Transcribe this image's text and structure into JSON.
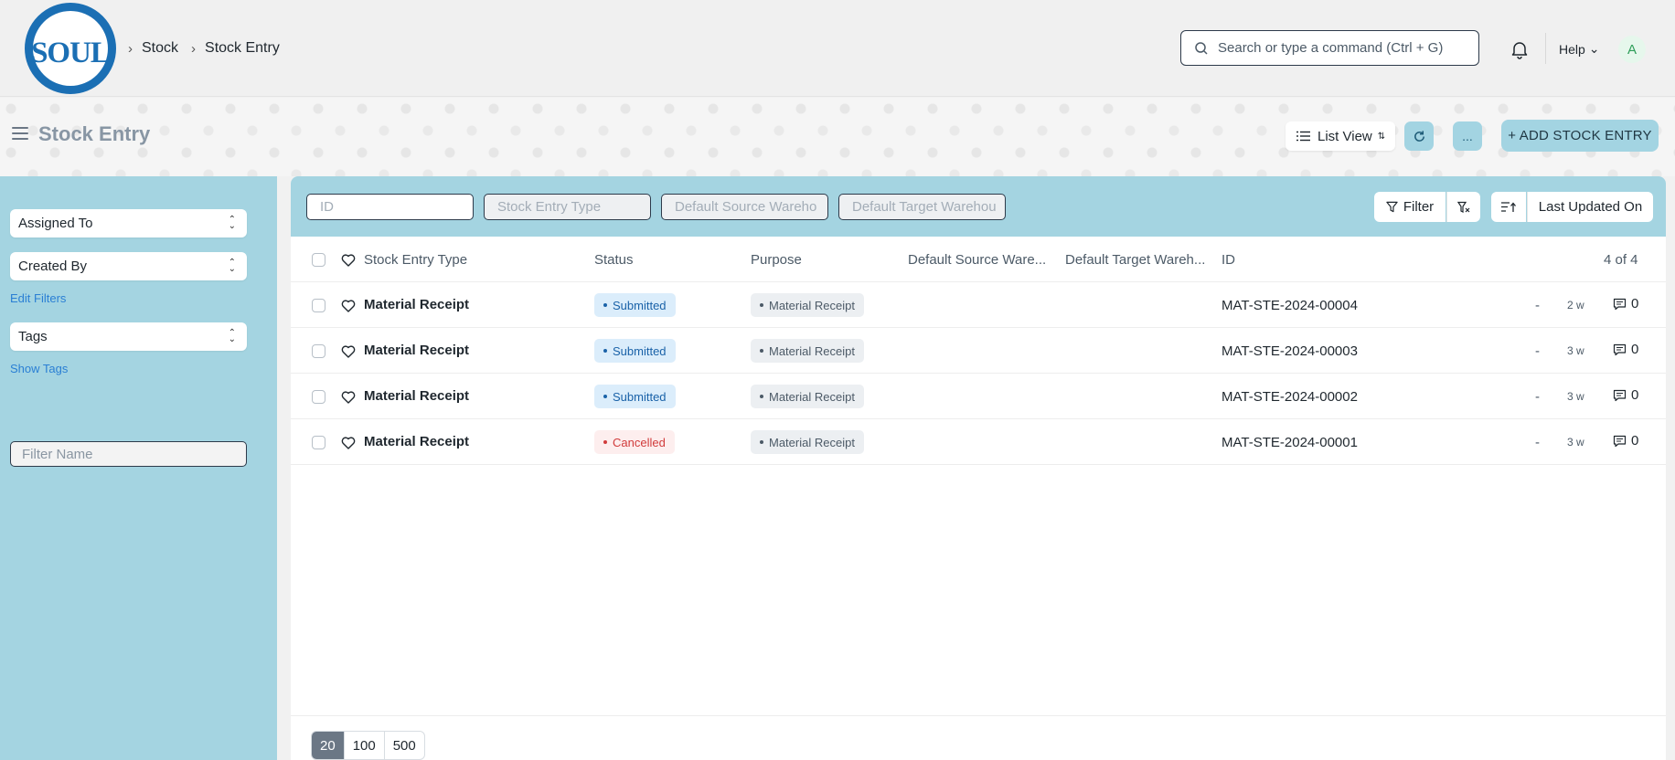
{
  "navbar": {
    "logo_text": "SOUL",
    "breadcrumbs": [
      "Stock",
      "Stock Entry"
    ],
    "search_placeholder": "Search or type a command (Ctrl + G)",
    "help_label": "Help",
    "avatar_initial": "A"
  },
  "page": {
    "title": "Stock Entry",
    "list_view_label": "List View",
    "more_label": "...",
    "add_button_label": "+ ADD STOCK ENTRY"
  },
  "sidebar": {
    "assigned_to": "Assigned To",
    "created_by": "Created By",
    "edit_filters": "Edit Filters",
    "tags": "Tags",
    "show_tags": "Show Tags",
    "filter_name_placeholder": "Filter Name"
  },
  "filters": {
    "id_placeholder": "ID",
    "type_placeholder": "Stock Entry Type",
    "source_placeholder": "Default Source Wareho",
    "target_placeholder": "Default Target Warehou",
    "filter_label": "Filter",
    "sort_label": "Last Updated On"
  },
  "table": {
    "headers": {
      "type": "Stock Entry Type",
      "status": "Status",
      "purpose": "Purpose",
      "source": "Default Source Ware...",
      "target": "Default Target Wareh...",
      "id": "ID",
      "count": "4 of 4"
    },
    "rows": [
      {
        "type": "Material Receipt",
        "status": "Submitted",
        "purpose": "Material Receipt",
        "id": "MAT-STE-2024-00004",
        "dash": "-",
        "age": "2 w",
        "comments": "0"
      },
      {
        "type": "Material Receipt",
        "status": "Submitted",
        "purpose": "Material Receipt",
        "id": "MAT-STE-2024-00003",
        "dash": "-",
        "age": "3 w",
        "comments": "0"
      },
      {
        "type": "Material Receipt",
        "status": "Submitted",
        "purpose": "Material Receipt",
        "id": "MAT-STE-2024-00002",
        "dash": "-",
        "age": "3 w",
        "comments": "0"
      },
      {
        "type": "Material Receipt",
        "status": "Cancelled",
        "purpose": "Material Receipt",
        "id": "MAT-STE-2024-00001",
        "dash": "-",
        "age": "3 w",
        "comments": "0"
      }
    ]
  },
  "pager": {
    "options": [
      "20",
      "100",
      "500"
    ],
    "active": "20"
  },
  "colors": {
    "accent": "#a4d4e1",
    "submitted": "#1a62a8",
    "cancelled": "#d13b3b"
  }
}
